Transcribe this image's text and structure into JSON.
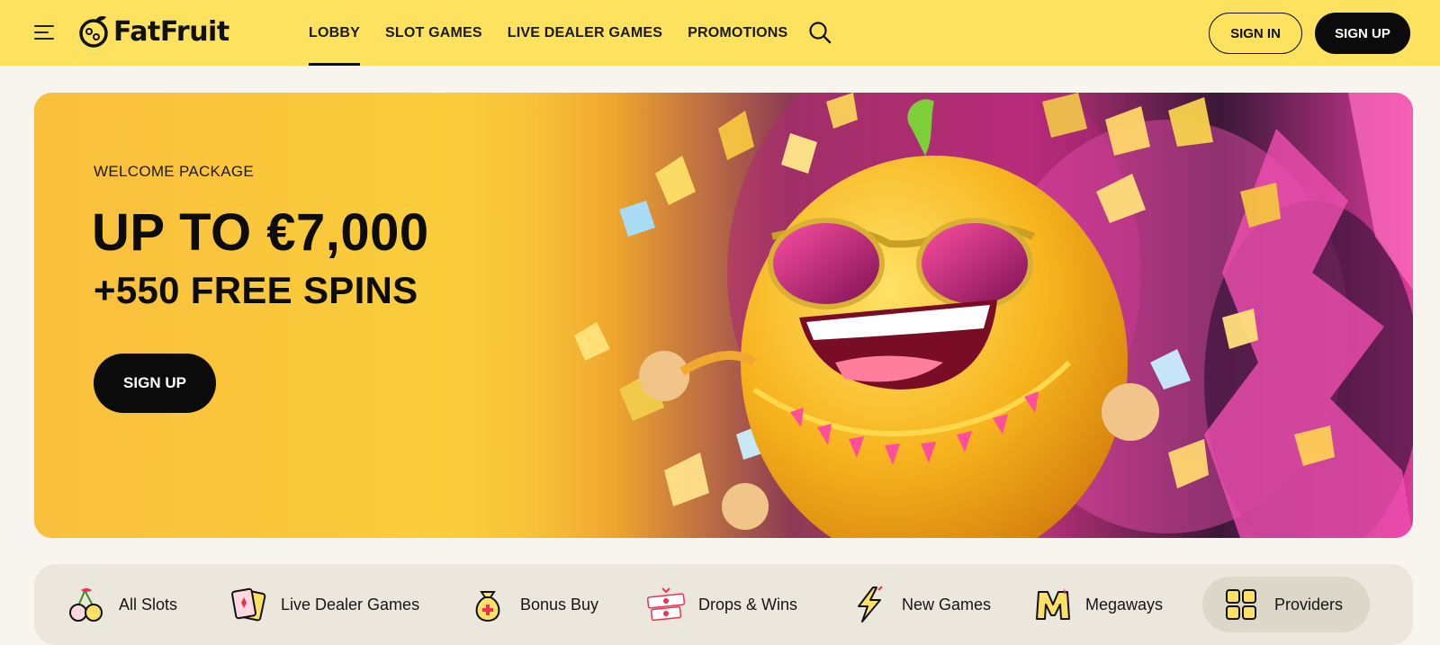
{
  "brand": {
    "name": "FatFruit"
  },
  "header": {
    "nav": [
      {
        "label": "LOBBY",
        "active": true
      },
      {
        "label": "SLOT GAMES",
        "active": false
      },
      {
        "label": "LIVE DEALER GAMES",
        "active": false
      },
      {
        "label": "PROMOTIONS",
        "active": false
      }
    ],
    "signin_label": "SIGN IN",
    "signup_label": "SIGN UP"
  },
  "hero": {
    "eyebrow": "WELCOME PACKAGE",
    "headline": "UP TO €7,000",
    "subheadline": "+550 FREE SPINS",
    "cta_label": "SIGN UP"
  },
  "categories": [
    {
      "label": "All Slots",
      "icon": "cherry-icon"
    },
    {
      "label": "Live Dealer Games",
      "icon": "playing-cards-icon"
    },
    {
      "label": "Bonus Buy",
      "icon": "money-bag-icon"
    },
    {
      "label": "Drops & Wins",
      "icon": "drops-wins-icon"
    },
    {
      "label": "New Games",
      "icon": "lightning-icon"
    },
    {
      "label": "Megaways",
      "icon": "megaways-icon"
    },
    {
      "label": "Providers",
      "icon": "grid-icon"
    }
  ],
  "colors": {
    "header_bg": "#fde25f",
    "page_bg": "#f8f5ee",
    "button_dark": "#0b0b0b",
    "category_bar_bg": "#ece7dc"
  }
}
